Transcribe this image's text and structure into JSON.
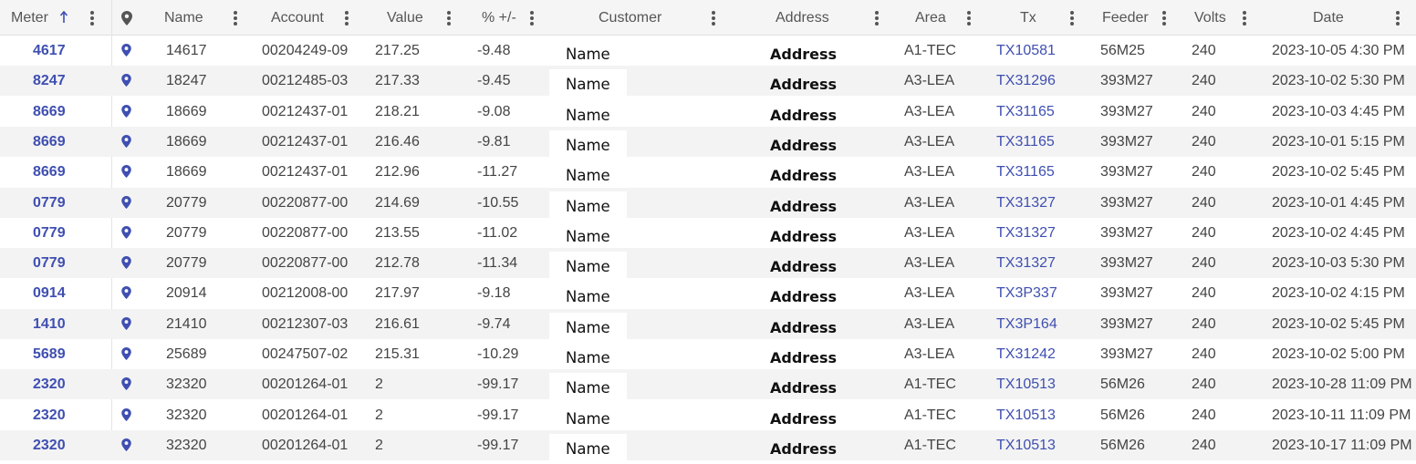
{
  "columns": [
    {
      "key": "meter",
      "label": "Meter"
    },
    {
      "key": "map",
      "label": ""
    },
    {
      "key": "name",
      "label": "Name"
    },
    {
      "key": "account",
      "label": "Account"
    },
    {
      "key": "value",
      "label": "Value"
    },
    {
      "key": "pct",
      "label": "% +/-"
    },
    {
      "key": "customer",
      "label": "Customer"
    },
    {
      "key": "address",
      "label": "Address"
    },
    {
      "key": "area",
      "label": "Area"
    },
    {
      "key": "tx",
      "label": "Tx"
    },
    {
      "key": "feeder",
      "label": "Feeder"
    },
    {
      "key": "volts",
      "label": "Volts"
    },
    {
      "key": "date",
      "label": "Date"
    }
  ],
  "sort": {
    "column": "meter",
    "direction": "ascending"
  },
  "colors": {
    "link": "#3f4fb1",
    "header_bg": "#f5f5f5",
    "alt_row": "#f3f3f3"
  },
  "icons": {
    "sort": "arrow-up-icon",
    "menu": "more-vert-icon",
    "map": "map-pin-icon"
  },
  "rows": [
    {
      "meter": "4617",
      "name": "14617",
      "account": "00204249-09",
      "value": "217.25",
      "pct": "-9.48",
      "customer": "Name",
      "address": "Address",
      "area": "A1-TEC",
      "tx": "TX10581",
      "feeder": "56M25",
      "volts": "240",
      "date": "2023-10-05 4:30 PM"
    },
    {
      "meter": "8247",
      "name": "18247",
      "account": "00212485-03",
      "value": "217.33",
      "pct": "-9.45",
      "customer": "Name",
      "address": "Address",
      "area": "A3-LEA",
      "tx": "TX31296",
      "feeder": "393M27",
      "volts": "240",
      "date": "2023-10-02 5:30 PM"
    },
    {
      "meter": "8669",
      "name": "18669",
      "account": "00212437-01",
      "value": "218.21",
      "pct": "-9.08",
      "customer": "Name",
      "address": "Address",
      "area": "A3-LEA",
      "tx": "TX31165",
      "feeder": "393M27",
      "volts": "240",
      "date": "2023-10-03 4:45 PM"
    },
    {
      "meter": "8669",
      "name": "18669",
      "account": "00212437-01",
      "value": "216.46",
      "pct": "-9.81",
      "customer": "Name",
      "address": "Address",
      "area": "A3-LEA",
      "tx": "TX31165",
      "feeder": "393M27",
      "volts": "240",
      "date": "2023-10-01 5:15 PM"
    },
    {
      "meter": "8669",
      "name": "18669",
      "account": "00212437-01",
      "value": "212.96",
      "pct": "-11.27",
      "customer": "Name",
      "address": "Address",
      "area": "A3-LEA",
      "tx": "TX31165",
      "feeder": "393M27",
      "volts": "240",
      "date": "2023-10-02 5:45 PM"
    },
    {
      "meter": "0779",
      "name": "20779",
      "account": "00220877-00",
      "value": "214.69",
      "pct": "-10.55",
      "customer": "Name",
      "address": "Address",
      "area": "A3-LEA",
      "tx": "TX31327",
      "feeder": "393M27",
      "volts": "240",
      "date": "2023-10-01 4:45 PM"
    },
    {
      "meter": "0779",
      "name": "20779",
      "account": "00220877-00",
      "value": "213.55",
      "pct": "-11.02",
      "customer": "Name",
      "address": "Address",
      "area": "A3-LEA",
      "tx": "TX31327",
      "feeder": "393M27",
      "volts": "240",
      "date": "2023-10-02 4:45 PM"
    },
    {
      "meter": "0779",
      "name": "20779",
      "account": "00220877-00",
      "value": "212.78",
      "pct": "-11.34",
      "customer": "Name",
      "address": "Address",
      "area": "A3-LEA",
      "tx": "TX31327",
      "feeder": "393M27",
      "volts": "240",
      "date": "2023-10-03 5:30 PM"
    },
    {
      "meter": "0914",
      "name": "20914",
      "account": "00212008-00",
      "value": "217.97",
      "pct": "-9.18",
      "customer": "Name",
      "address": "Address",
      "area": "A3-LEA",
      "tx": "TX3P337",
      "feeder": "393M27",
      "volts": "240",
      "date": "2023-10-02 4:15 PM"
    },
    {
      "meter": "1410",
      "name": "21410",
      "account": "00212307-03",
      "value": "216.61",
      "pct": "-9.74",
      "customer": "Name",
      "address": "Address",
      "area": "A3-LEA",
      "tx": "TX3P164",
      "feeder": "393M27",
      "volts": "240",
      "date": "2023-10-02 5:45 PM"
    },
    {
      "meter": "5689",
      "name": "25689",
      "account": "00247507-02",
      "value": "215.31",
      "pct": "-10.29",
      "customer": "Name",
      "address": "Address",
      "area": "A3-LEA",
      "tx": "TX31242",
      "feeder": "393M27",
      "volts": "240",
      "date": "2023-10-02 5:00 PM"
    },
    {
      "meter": "2320",
      "name": "32320",
      "account": "00201264-01",
      "value": "2",
      "pct": "-99.17",
      "customer": "Name",
      "address": "Address",
      "area": "A1-TEC",
      "tx": "TX10513",
      "feeder": "56M26",
      "volts": "240",
      "date": "2023-10-28 11:09 PM"
    },
    {
      "meter": "2320",
      "name": "32320",
      "account": "00201264-01",
      "value": "2",
      "pct": "-99.17",
      "customer": "Name",
      "address": "Address",
      "area": "A1-TEC",
      "tx": "TX10513",
      "feeder": "56M26",
      "volts": "240",
      "date": "2023-10-11 11:09 PM"
    },
    {
      "meter": "2320",
      "name": "32320",
      "account": "00201264-01",
      "value": "2",
      "pct": "-99.17",
      "customer": "Name",
      "address": "Address",
      "area": "A1-TEC",
      "tx": "TX10513",
      "feeder": "56M26",
      "volts": "240",
      "date": "2023-10-17 11:09 PM"
    }
  ]
}
